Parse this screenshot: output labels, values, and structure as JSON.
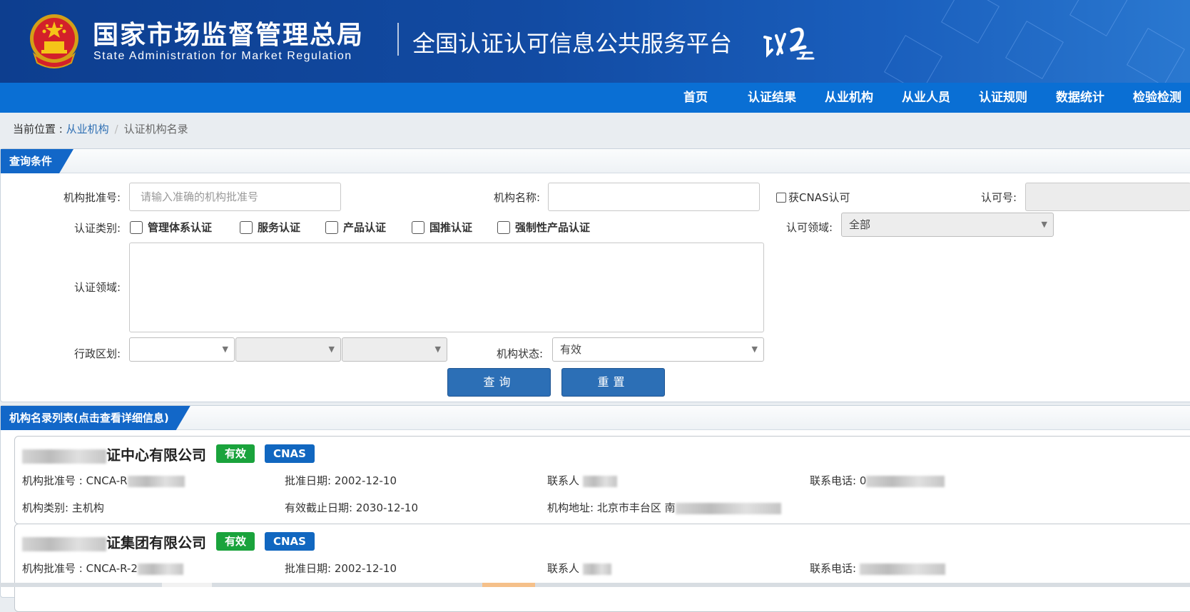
{
  "header": {
    "org_cn": "国家市场监督管理总局",
    "org_en": "State Administration  for  Market Regulation",
    "platform": "全国认证认可信息公共服务平台",
    "colors": {
      "banner": "#124ba3",
      "nav": "#0a6fd4"
    }
  },
  "nav": {
    "items": [
      "首页",
      "认证结果",
      "从业机构",
      "从业人员",
      "认证规则",
      "数据统计",
      "检验检测"
    ]
  },
  "breadcrumb": {
    "prefix": "当前位置 : ",
    "link": "从业机构",
    "sep": "/",
    "current": "认证机构名录"
  },
  "query": {
    "title": "查询条件",
    "approval_no_label": "机构批准号:",
    "approval_no_placeholder": "请输入准确的机构批准号",
    "name_label": "机构名称:",
    "name_value": "",
    "cnas_label": "获CNAS认可",
    "accr_no_label": "认可号:",
    "cert_type_label": "认证类别:",
    "cert_types": [
      "管理体系认证",
      "服务认证",
      "产品认证",
      "国推认证",
      "强制性产品认证"
    ],
    "accr_field_label": "认可领域:",
    "accr_field_value": "全部",
    "cert_field_label": "认证领域:",
    "region_label": "行政区划:",
    "status_label": "机构状态:",
    "status_value": "有效",
    "search_btn": "查询",
    "reset_btn": "重置"
  },
  "list": {
    "title": "机构名录列表(点击查看详细信息)",
    "items": [
      {
        "name_tail": "证中心有限公司",
        "status": "有效",
        "cnas": "CNAS",
        "approval_label": "机构批准号 : ",
        "approval_value": "CNCA-R",
        "date_label": "批准日期: ",
        "date": "2002-12-10",
        "contact_label": "联系人",
        "phone_label": "联系电话: ",
        "phone_value": "0",
        "type_label": "机构类别: ",
        "type_value": "主机构",
        "expiry_label": "有效截止日期: ",
        "expiry": "2030-12-10",
        "address_label": "机构地址: ",
        "address_value": "北京市丰台区  南"
      },
      {
        "name_tail": "证集团有限公司",
        "status": "有效",
        "cnas": "CNAS",
        "approval_label": "机构批准号 : ",
        "approval_value": "CNCA-R-2",
        "date_label": "批准日期: ",
        "date": "2002-12-10",
        "contact_label": "联系人",
        "phone_label": "联系电话: ",
        "phone_value": ""
      }
    ]
  }
}
